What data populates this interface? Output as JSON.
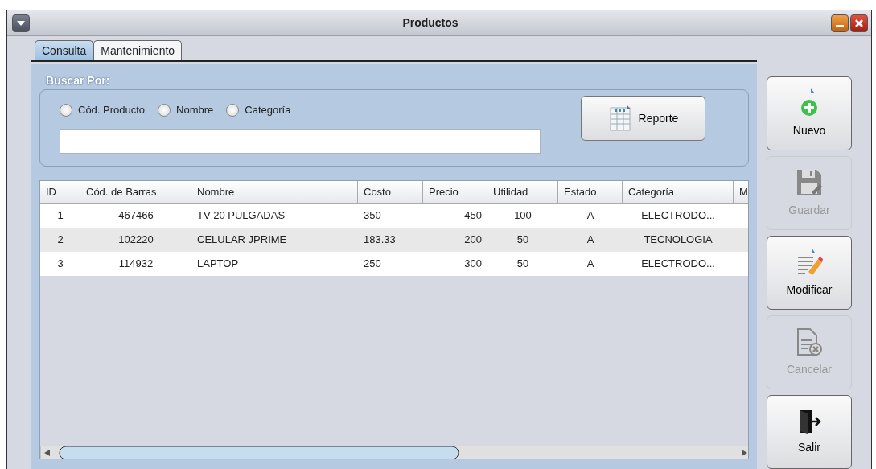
{
  "window": {
    "title": "Productos"
  },
  "tabs": [
    {
      "label": "Consulta",
      "selected": true
    },
    {
      "label": "Mantenimiento",
      "selected": false
    }
  ],
  "search": {
    "legend": "Buscar Por:",
    "options": [
      {
        "label": "Cód. Producto",
        "selected": false
      },
      {
        "label": "Nombre",
        "selected": false
      },
      {
        "label": "Categoría",
        "selected": false
      }
    ],
    "report_button": "Reporte"
  },
  "table": {
    "columns": [
      "ID",
      "Cód. de Barras",
      "Nombre",
      "Costo",
      "Precio",
      "Utilidad",
      "Estado",
      "Categoría",
      "M"
    ],
    "rows": [
      [
        "1",
        "467466",
        "TV 20 PULGADAS",
        "350",
        "450",
        "100",
        "A",
        "ELECTRODO..."
      ],
      [
        "2",
        "102220",
        "CELULAR JPRIME",
        "183.33",
        "200",
        "50",
        "A",
        "TECNOLOGIA"
      ],
      [
        "3",
        "114932",
        "LAPTOP",
        "250",
        "300",
        "50",
        "A",
        "ELECTRODO..."
      ]
    ]
  },
  "actions": [
    {
      "label": "Nuevo",
      "kind": "new",
      "disabled": false
    },
    {
      "label": "Guardar",
      "kind": "save",
      "disabled": true
    },
    {
      "label": "Modificar",
      "kind": "edit",
      "disabled": false
    },
    {
      "label": "Cancelar",
      "kind": "cancel",
      "disabled": true
    },
    {
      "label": "Salir",
      "kind": "exit",
      "disabled": false
    }
  ]
}
